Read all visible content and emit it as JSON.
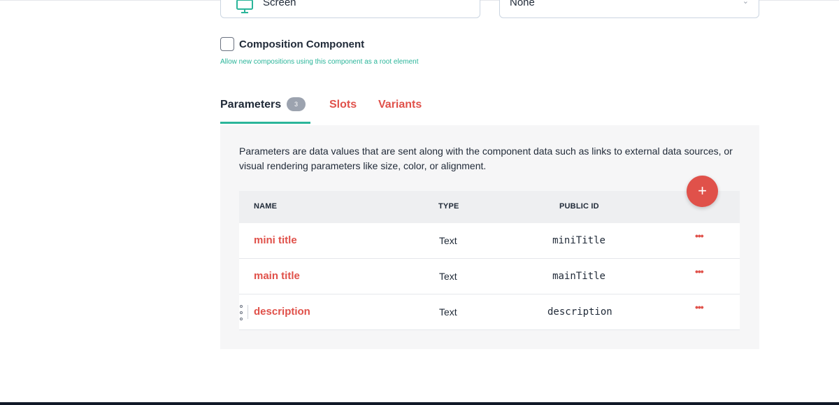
{
  "fields": {
    "type_value": "Screen",
    "icon_value": "None"
  },
  "composition": {
    "label": "Composition Component",
    "help": "Allow new compositions using this component as a root element",
    "checked": false
  },
  "tabs": [
    {
      "label": "Parameters",
      "badge": "3",
      "active": true
    },
    {
      "label": "Slots"
    },
    {
      "label": "Variants"
    }
  ],
  "parameters": {
    "description": "Parameters are data values that are sent along with the component data such as links to external data sources, or visual rendering parameters like size, color, or alignment.",
    "add_label": "+",
    "headers": {
      "name": "NAME",
      "type": "TYPE",
      "public_id": "PUBLIC ID"
    },
    "rows": [
      {
        "name": "mini title",
        "type": "Text",
        "public_id": "miniTitle",
        "more": "•••"
      },
      {
        "name": "main title",
        "type": "Text",
        "public_id": "mainTitle",
        "more": "•••"
      },
      {
        "name": "description",
        "type": "Text",
        "public_id": "description",
        "more": "•••"
      }
    ]
  },
  "colors": {
    "accent_red": "#e0514a",
    "accent_teal": "#2bb59a"
  }
}
